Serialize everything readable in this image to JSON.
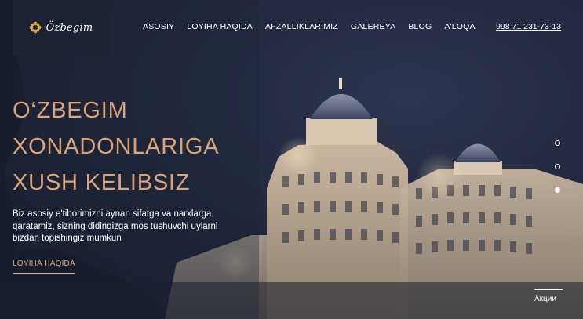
{
  "brand": {
    "name": "Özbegim",
    "logo_icon": "flower-ornament-icon"
  },
  "nav": {
    "items": [
      "ASOSIY",
      "LOYIHA HAQIDA",
      "AFZALLIKLARIMIZ",
      "GALEREYA",
      "BLOG",
      "A'LOQA"
    ]
  },
  "contact": {
    "phone": "998 71 231-73-13"
  },
  "hero": {
    "title_lines": [
      "O‘ZBEGIM",
      "XONADONLARIGA",
      "XUSH KELIBSIZ"
    ],
    "description": "Biz asosiy e'tiborimizni aynan sifatga va narxlarga qaratamiz, sizning didingizga mos tushuvchi uylarni bizdan topishingiz mumkun",
    "cta_label": "LOYIHA HAQIDA",
    "slider_dots": 3,
    "active_dot": 3
  },
  "promo": {
    "label": "Акции"
  },
  "colors": {
    "accent": "#d9a47a",
    "background": "#1e2437",
    "text": "#ffffff"
  }
}
